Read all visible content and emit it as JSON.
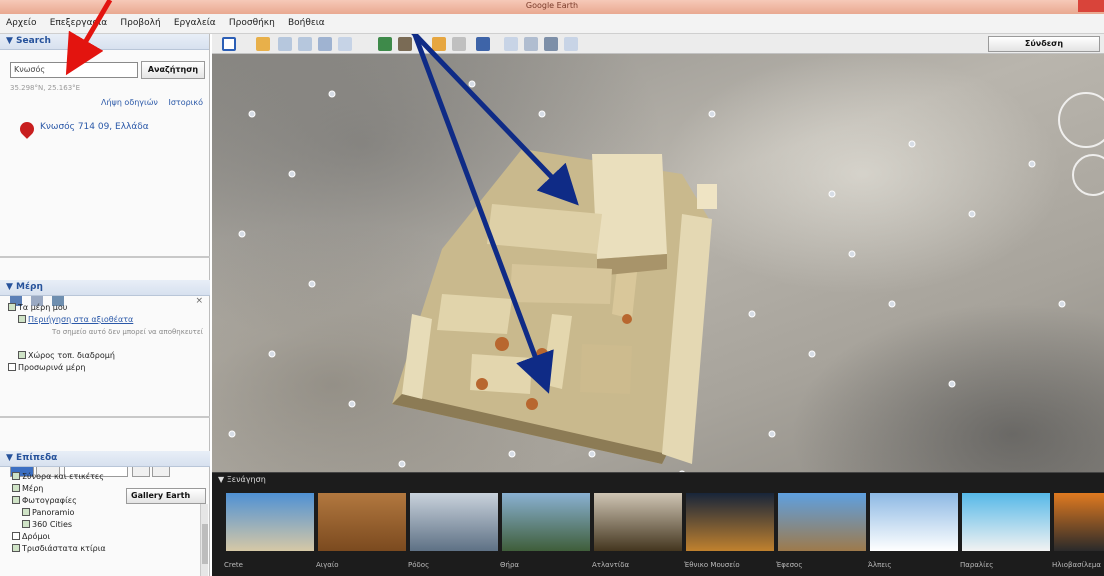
{
  "window": {
    "title": "Google Earth"
  },
  "menu": [
    "Αρχείο",
    "Επεξεργασία",
    "Προβολή",
    "Εργαλεία",
    "Προσθήκη",
    "Βοήθεια"
  ],
  "search": {
    "header": "▼ Search",
    "value": "Κνωσός",
    "button": "Αναζήτηση",
    "coords": "35.298°N, 25.163°E",
    "link1": "Λήψη οδηγιών",
    "link2": "Ιστορικό",
    "result": "Κνωσός 714 09, Ελλάδα"
  },
  "places": {
    "header": "▼ Μέρη",
    "items": [
      "Τα μέρη μου",
      "Περιήγηση στα αξιοθέατα",
      "Το σημείο αυτό δεν μπορεί να αποθηκευτεί",
      "Χώρος τοπ. διαδρομή",
      "Προσωρινά μέρη"
    ]
  },
  "layers": {
    "header": "▼ Επίπεδα",
    "gallery": "Gallery Earth",
    "items": [
      "Σύνορα και ετικέτες",
      "Μέρη",
      "Φωτογραφίες",
      "Panoramio",
      "360 Cities",
      "Δρόμοι",
      "Τρισδιάστατα κτίρια"
    ]
  },
  "toolbar": {
    "signin": "Σύνδεση"
  },
  "tour": {
    "header": "▼ Ξενάγηση",
    "captions": [
      "Crete",
      "Αιγαίο",
      "Ρόδος",
      "Θήρα",
      "Ατλαντίδα",
      "Έθνικο Μουσείο",
      "Έφεσος",
      "Άλπεις",
      "Παραλίες",
      "Ηλιοβασίλεμα"
    ]
  },
  "colors": {
    "accent_arrow": "#e3140f",
    "nav_arrow": "#0f2b86",
    "header_text": "#26529b",
    "link": "#2a58a8"
  }
}
